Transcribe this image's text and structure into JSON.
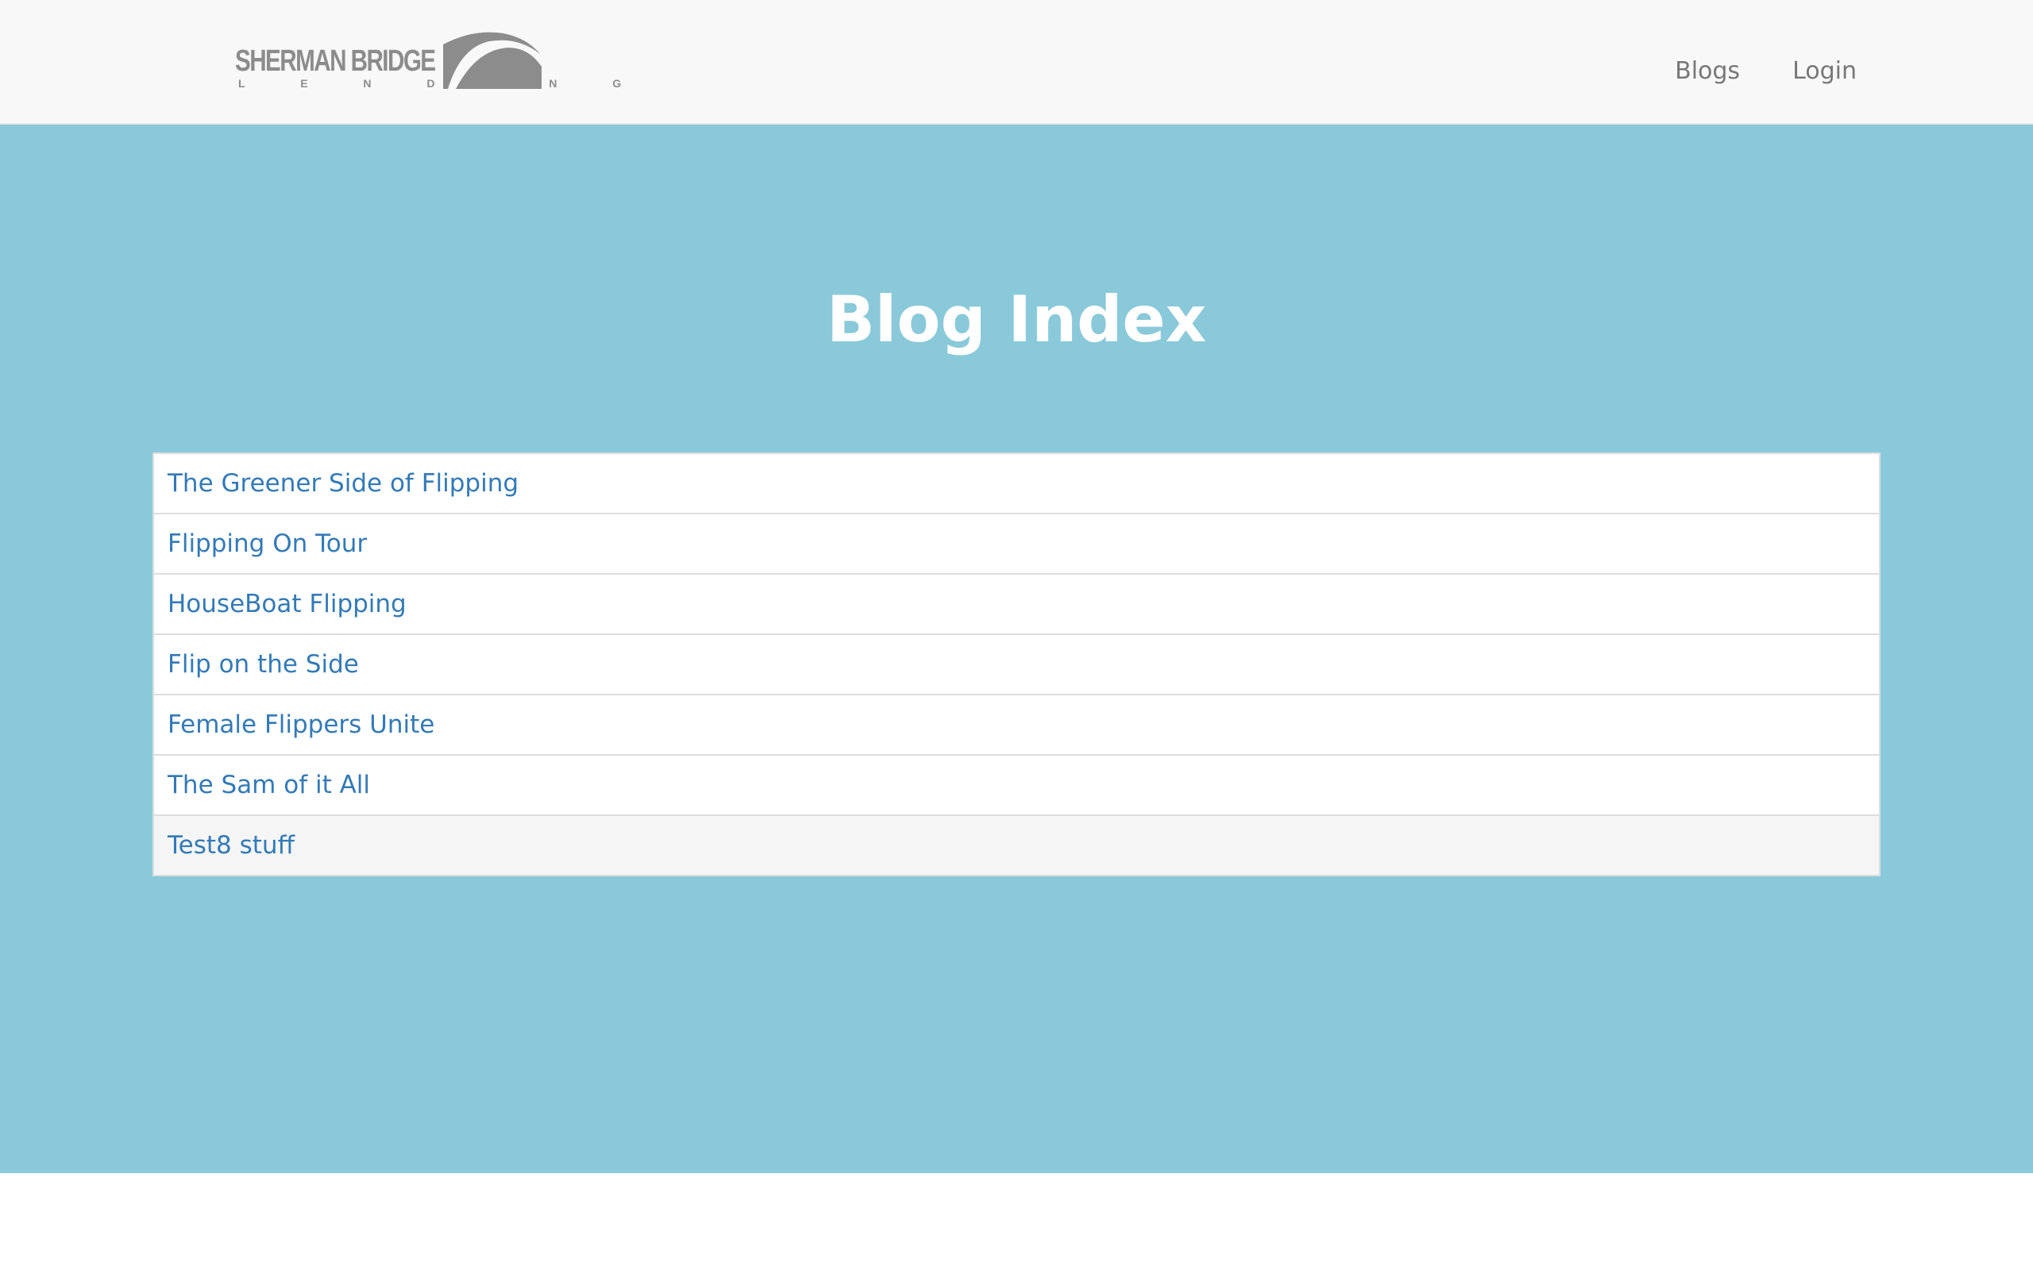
{
  "brand": {
    "name": "SHERMAN BRIDGE",
    "subtitle": "L E N D I N G"
  },
  "nav": {
    "blogs_label": "Blogs",
    "login_label": "Login"
  },
  "page": {
    "title": "Blog Index"
  },
  "blogs": [
    "The Greener Side of Flipping",
    "Flipping On Tour",
    "HouseBoat Flipping",
    "Flip on the Side",
    "Female Flippers Unite",
    "The Sam of it All",
    "Test8 stuff"
  ],
  "colors": {
    "navbar_bg": "#f8f8f8",
    "hero_bg": "#89c9d9",
    "link": "#337ab7",
    "nav_text": "#777777",
    "logo_gray": "#8c8c8c"
  }
}
